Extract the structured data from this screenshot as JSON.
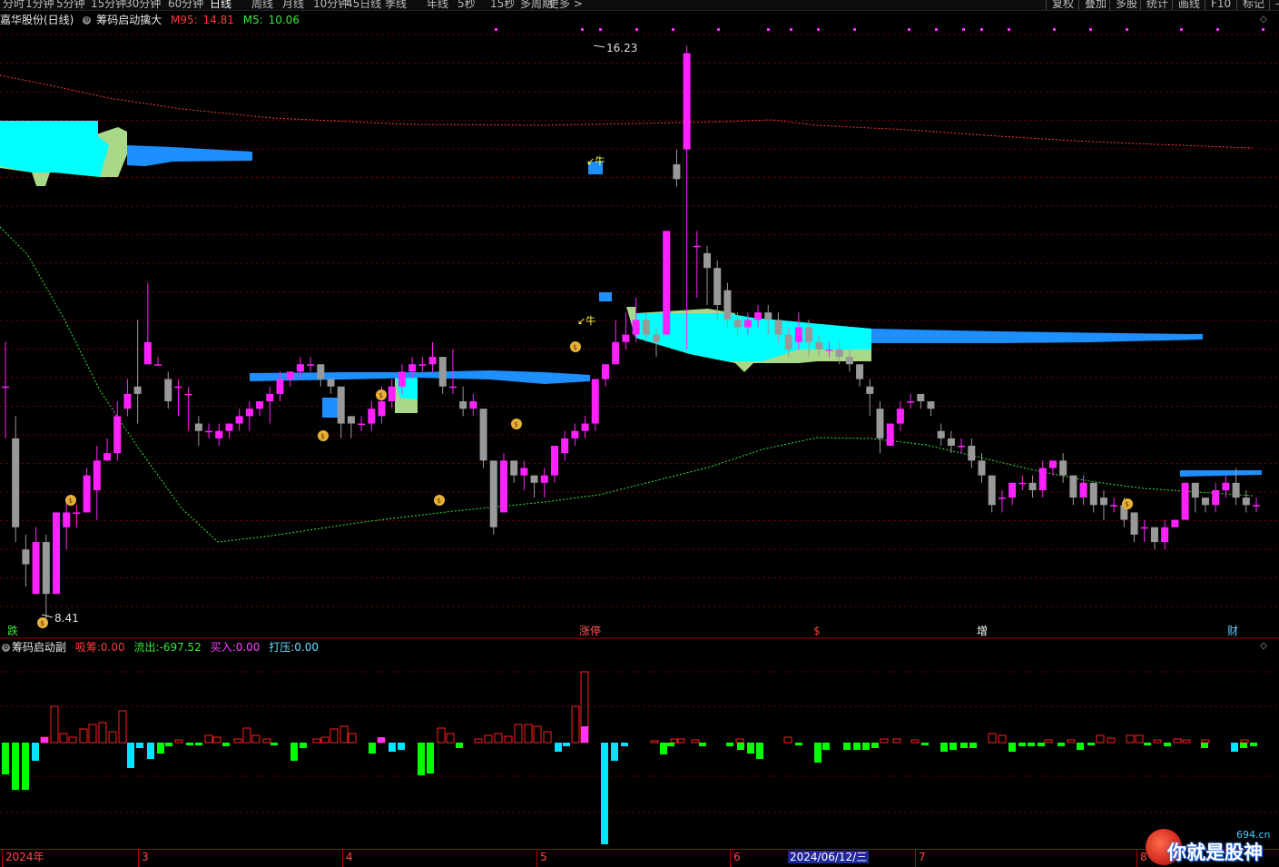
{
  "toolbar": {
    "periods": [
      "分时",
      "1分钟",
      "5分钟",
      "15分钟",
      "30分钟",
      "60分钟",
      "日线",
      "周线",
      "月线",
      "10分钟",
      "45日线",
      "季线",
      "年线",
      "5秒",
      "15秒",
      "多周期",
      "更多 >"
    ],
    "active_period": "日线",
    "right_buttons": [
      "复权",
      "叠加",
      "多股",
      "统计",
      "画线",
      "F10",
      "标记",
      "-品"
    ]
  },
  "main_header": {
    "stock": "嘉华股份(日线)",
    "indicator": "筹码启动擒大",
    "m95_label": "M95:",
    "m95_value": "14.81",
    "m5_label": "M5:",
    "m5_value": "10.06"
  },
  "price_labels": {
    "high": "16.23",
    "low": "8.41"
  },
  "signal_label": "牛",
  "markers": [
    {
      "text": "跌",
      "color": "#39e639"
    },
    {
      "text": "涨停",
      "color": "#ff5555"
    },
    {
      "text": "$",
      "color": "#ff3b3b"
    },
    {
      "text": "增",
      "color": "#ffffff"
    },
    {
      "text": "财",
      "color": "#66ccff"
    }
  ],
  "sub_header": {
    "name": "筹码启动副",
    "xichou_label": "吸筹:",
    "xichou_value": "0.00",
    "liuchu_label": "流出:",
    "liuchu_value": "-697.52",
    "mairu_label": "买入:",
    "mairu_value": "0.00",
    "daya_label": "打压:",
    "daya_value": "0.00"
  },
  "time_axis": {
    "labels": [
      "2024年",
      "3",
      "4",
      "5",
      "6",
      "7",
      "8"
    ],
    "selected_date": "2024/06/12/三"
  },
  "watermark": {
    "text": "你就是股神",
    "site": "694.cn"
  },
  "colors": {
    "up": "#ff22ff",
    "down": "#999999",
    "cyan": "#00ffff",
    "blue": "#1e8fff",
    "green_band": "#a8d888",
    "ma95": "#ff3b3b",
    "ma5": "#39e639",
    "sub_red": "#ff2020",
    "sub_green": "#00ff00",
    "sub_cyan": "#00e5ff"
  },
  "chart_data": {
    "type": "candlestick",
    "price_range": [
      8.0,
      17.0
    ],
    "candles": [
      [
        11.6,
        11.6,
        12.2,
        10.9
      ],
      [
        10.9,
        9.7,
        11.2,
        9.5
      ],
      [
        9.4,
        9.2,
        9.6,
        8.9
      ],
      [
        8.8,
        9.5,
        9.7,
        8.8
      ],
      [
        9.5,
        8.8,
        9.6,
        8.4
      ],
      [
        8.8,
        9.9,
        9.9,
        8.8
      ],
      [
        9.7,
        9.9,
        10.1,
        9.4
      ],
      [
        9.9,
        9.9,
        10.0,
        9.7
      ],
      [
        9.9,
        10.4,
        10.5,
        9.9
      ],
      [
        10.2,
        10.6,
        10.8,
        9.8
      ],
      [
        10.6,
        10.7,
        10.9,
        10.6
      ],
      [
        10.7,
        11.2,
        11.4,
        10.6
      ],
      [
        11.3,
        11.5,
        11.7,
        11.2
      ],
      [
        11.6,
        11.5,
        12.5,
        11.1
      ],
      [
        11.9,
        12.2,
        13.0,
        11.9
      ],
      [
        11.9,
        11.9,
        12.0,
        11.9
      ],
      [
        11.7,
        11.4,
        11.8,
        11.3
      ],
      [
        11.6,
        11.6,
        11.7,
        11.2
      ],
      [
        11.5,
        11.5,
        11.6,
        11.0
      ],
      [
        11.1,
        11.0,
        11.2,
        10.8
      ],
      [
        11.0,
        11.0,
        11.1,
        10.9
      ],
      [
        10.9,
        11.0,
        11.1,
        10.8
      ],
      [
        11.0,
        11.1,
        11.1,
        10.9
      ],
      [
        11.1,
        11.2,
        11.3,
        11.0
      ],
      [
        11.2,
        11.3,
        11.4,
        11.0
      ],
      [
        11.3,
        11.4,
        11.4,
        11.2
      ],
      [
        11.4,
        11.5,
        11.6,
        11.1
      ],
      [
        11.5,
        11.7,
        11.8,
        11.4
      ],
      [
        11.7,
        11.8,
        11.8,
        11.6
      ],
      [
        11.8,
        11.9,
        12.0,
        11.7
      ],
      [
        11.9,
        11.9,
        12.0,
        11.8
      ],
      [
        11.9,
        11.7,
        11.9,
        11.6
      ],
      [
        11.7,
        11.6,
        11.7,
        11.5
      ],
      [
        11.6,
        11.1,
        11.6,
        10.9
      ],
      [
        11.2,
        11.1,
        11.2,
        10.9
      ],
      [
        11.1,
        11.1,
        11.2,
        11.0
      ],
      [
        11.1,
        11.3,
        11.4,
        11.0
      ],
      [
        11.2,
        11.4,
        11.6,
        11.1
      ],
      [
        11.4,
        11.6,
        11.7,
        11.3
      ],
      [
        11.6,
        11.8,
        11.9,
        11.5
      ],
      [
        11.8,
        11.9,
        12.0,
        11.7
      ],
      [
        11.9,
        11.9,
        12.0,
        11.8
      ],
      [
        11.9,
        12.0,
        12.2,
        11.8
      ],
      [
        12.0,
        11.6,
        12.0,
        11.5
      ],
      [
        11.6,
        11.6,
        12.1,
        11.5
      ],
      [
        11.4,
        11.3,
        11.6,
        11.2
      ],
      [
        11.3,
        11.4,
        11.5,
        11.2
      ],
      [
        11.3,
        10.6,
        11.3,
        10.5
      ],
      [
        10.6,
        9.7,
        10.6,
        9.6
      ],
      [
        9.9,
        10.6,
        10.7,
        9.9
      ],
      [
        10.6,
        10.4,
        10.6,
        10.3
      ],
      [
        10.4,
        10.5,
        10.6,
        10.2
      ],
      [
        10.4,
        10.3,
        10.4,
        10.1
      ],
      [
        10.3,
        10.4,
        10.5,
        10.1
      ],
      [
        10.4,
        10.8,
        10.8,
        10.3
      ],
      [
        10.7,
        10.9,
        11.0,
        10.6
      ],
      [
        10.9,
        11.0,
        11.1,
        10.8
      ],
      [
        11.0,
        11.1,
        11.2,
        10.9
      ],
      [
        11.1,
        11.7,
        11.7,
        11.0
      ],
      [
        11.7,
        11.9,
        11.9,
        11.6
      ],
      [
        11.9,
        12.2,
        12.5,
        11.9
      ],
      [
        12.2,
        12.3,
        12.6,
        12.1
      ],
      [
        12.3,
        12.5,
        12.8,
        12.2
      ],
      [
        12.5,
        12.3,
        12.6,
        12.2
      ],
      [
        12.3,
        12.2,
        12.4,
        12.0
      ],
      [
        12.3,
        13.7,
        13.7,
        12.3
      ],
      [
        14.6,
        14.4,
        14.8,
        14.3
      ],
      [
        14.8,
        16.1,
        16.2,
        12.1
      ],
      [
        13.5,
        13.5,
        13.7,
        12.8
      ],
      [
        13.4,
        13.2,
        13.5,
        12.7
      ],
      [
        13.2,
        12.7,
        13.3,
        12.5
      ],
      [
        12.9,
        12.5,
        13.0,
        12.4
      ],
      [
        12.5,
        12.4,
        12.6,
        12.3
      ],
      [
        12.4,
        12.5,
        12.6,
        12.3
      ],
      [
        12.5,
        12.6,
        12.7,
        12.4
      ],
      [
        12.6,
        12.5,
        12.7,
        12.3
      ],
      [
        12.5,
        12.3,
        12.6,
        12.2
      ],
      [
        12.3,
        12.1,
        12.4,
        12.0
      ],
      [
        12.2,
        12.4,
        12.6,
        12.1
      ],
      [
        12.4,
        12.2,
        12.5,
        12.0
      ],
      [
        12.2,
        12.1,
        12.3,
        12.0
      ],
      [
        12.1,
        12.1,
        12.2,
        12.0
      ],
      [
        12.1,
        12.0,
        12.2,
        11.9
      ],
      [
        12.0,
        11.9,
        12.1,
        11.8
      ],
      [
        11.9,
        11.7,
        11.9,
        11.6
      ],
      [
        11.6,
        11.5,
        11.7,
        11.2
      ],
      [
        11.3,
        10.9,
        11.4,
        10.7
      ],
      [
        10.8,
        11.1,
        11.1,
        10.8
      ],
      [
        11.1,
        11.3,
        11.4,
        11.0
      ],
      [
        11.4,
        11.4,
        11.5,
        11.3
      ],
      [
        11.5,
        11.4,
        11.5,
        11.3
      ],
      [
        11.4,
        11.3,
        11.4,
        11.2
      ],
      [
        11.0,
        10.9,
        11.1,
        10.8
      ],
      [
        10.9,
        10.8,
        11.0,
        10.7
      ],
      [
        10.8,
        10.8,
        10.9,
        10.7
      ],
      [
        10.8,
        10.6,
        10.9,
        10.5
      ],
      [
        10.6,
        10.4,
        10.7,
        10.3
      ],
      [
        10.4,
        10.0,
        10.4,
        9.9
      ],
      [
        10.1,
        10.1,
        10.2,
        9.9
      ],
      [
        10.1,
        10.3,
        10.3,
        10.0
      ],
      [
        10.3,
        10.3,
        10.4,
        10.2
      ],
      [
        10.3,
        10.2,
        10.4,
        10.1
      ],
      [
        10.2,
        10.5,
        10.6,
        10.1
      ],
      [
        10.5,
        10.6,
        10.6,
        10.4
      ],
      [
        10.6,
        10.4,
        10.7,
        10.3
      ],
      [
        10.4,
        10.1,
        10.4,
        10.0
      ],
      [
        10.1,
        10.3,
        10.4,
        10.0
      ],
      [
        10.3,
        10.0,
        10.3,
        9.9
      ],
      [
        10.1,
        10.0,
        10.2,
        9.8
      ],
      [
        10.0,
        10.0,
        10.1,
        9.9
      ],
      [
        10.0,
        9.8,
        10.1,
        9.7
      ],
      [
        9.9,
        9.6,
        9.9,
        9.5
      ],
      [
        9.7,
        9.7,
        9.8,
        9.5
      ],
      [
        9.7,
        9.5,
        9.7,
        9.4
      ],
      [
        9.5,
        9.7,
        9.8,
        9.4
      ],
      [
        9.7,
        9.8,
        9.8,
        9.7
      ],
      [
        9.8,
        10.3,
        10.3,
        9.8
      ],
      [
        10.3,
        10.1,
        10.3,
        9.9
      ],
      [
        10.1,
        10.0,
        10.1,
        9.9
      ],
      [
        10.0,
        10.2,
        10.3,
        9.9
      ],
      [
        10.2,
        10.3,
        10.4,
        10.1
      ],
      [
        10.3,
        10.1,
        10.5,
        10.0
      ],
      [
        10.1,
        10.0,
        10.2,
        9.9
      ],
      [
        10.0,
        10.0,
        10.1,
        9.9
      ]
    ],
    "ma95": [
      14.81
    ],
    "ma5": [
      10.06
    ],
    "sub_values": {
      "xichou": 0.0,
      "liuchu": -697.52,
      "mairu": 0.0,
      "daya": 0.0
    }
  }
}
